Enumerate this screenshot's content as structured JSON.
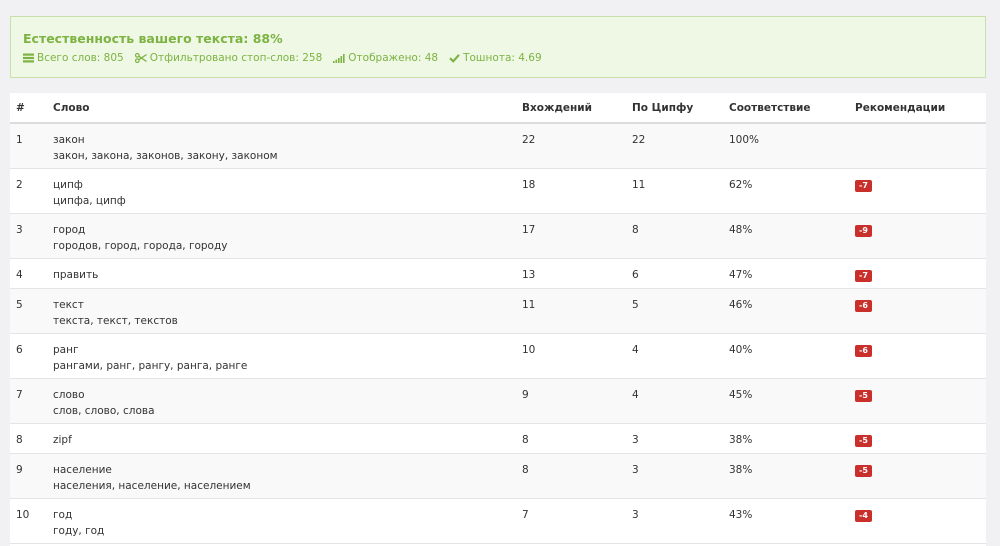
{
  "summary": {
    "title": "Естественность вашего текста: 88%",
    "total_words": "Всего слов: 805",
    "filtered": "Отфильтровано стоп-слов: 258",
    "displayed": "Отображено: 48",
    "nausea": "Тошнота: 4.69",
    "accent_color": "#7cb342"
  },
  "table": {
    "headers": [
      "#",
      "Слово",
      "Вхождений",
      "По Ципфу",
      "Соответствие",
      "Рекомендации"
    ],
    "rows": [
      {
        "num": "1",
        "word": "закон",
        "forms": "закон, закона, законов, закону, законом",
        "count": "22",
        "zipf": "22",
        "match": "100%",
        "rec": ""
      },
      {
        "num": "2",
        "word": "ципф",
        "forms": "ципфа, ципф",
        "count": "18",
        "zipf": "11",
        "match": "62%",
        "rec": "-7"
      },
      {
        "num": "3",
        "word": "город",
        "forms": "городов, город, города, городу",
        "count": "17",
        "zipf": "8",
        "match": "48%",
        "rec": "-9"
      },
      {
        "num": "4",
        "word": "править",
        "forms": "",
        "count": "13",
        "zipf": "6",
        "match": "47%",
        "rec": "-7"
      },
      {
        "num": "5",
        "word": "текст",
        "forms": "текста, текст, текстов",
        "count": "11",
        "zipf": "5",
        "match": "46%",
        "rec": "-6"
      },
      {
        "num": "6",
        "word": "ранг",
        "forms": "рангами, ранг, рангу, ранга, ранге",
        "count": "10",
        "zipf": "4",
        "match": "40%",
        "rec": "-6"
      },
      {
        "num": "7",
        "word": "слово",
        "forms": "слов, слово, слова",
        "count": "9",
        "zipf": "4",
        "match": "45%",
        "rec": "-5"
      },
      {
        "num": "8",
        "word": "zipf",
        "forms": "",
        "count": "8",
        "zipf": "3",
        "match": "38%",
        "rec": "-5"
      },
      {
        "num": "9",
        "word": "население",
        "forms": "населения, население, населением",
        "count": "8",
        "zipf": "3",
        "match": "38%",
        "rec": "-5"
      },
      {
        "num": "10",
        "word": "год",
        "forms": "году, год",
        "count": "7",
        "zipf": "3",
        "match": "43%",
        "rec": "-4"
      }
    ]
  },
  "icons": [
    "list-icon",
    "scissors-icon",
    "bar-signal-icon",
    "check-icon"
  ],
  "badge_color": "#c9302c"
}
